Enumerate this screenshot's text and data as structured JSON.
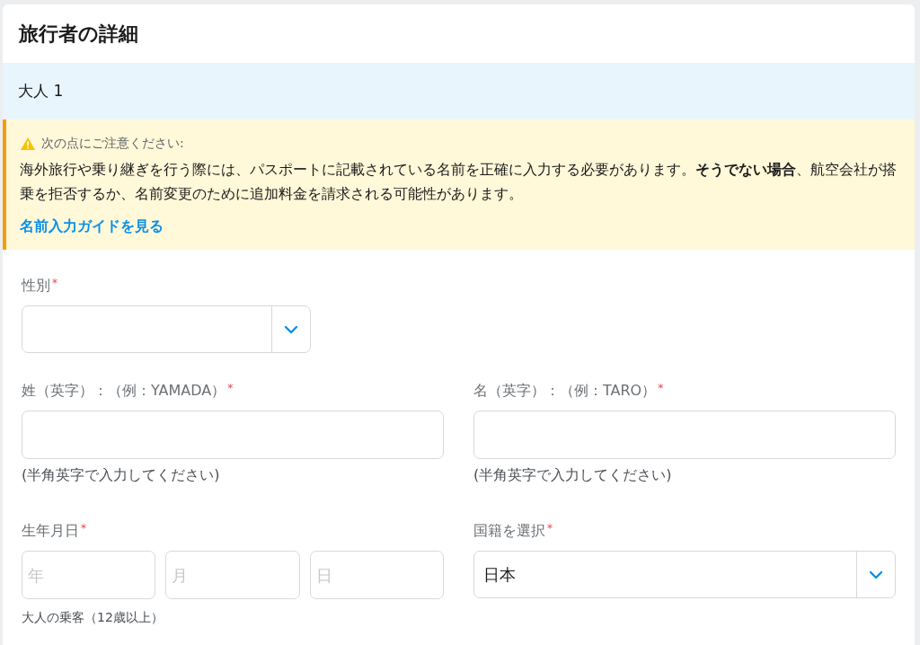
{
  "title": "旅行者の詳細",
  "passenger": "大人 1",
  "notice": {
    "heading": "次の点にご注意ください:",
    "body": "海外旅行や乗り継ぎを行う際には、パスポートに記載されている名前を正確に入力する必要があります。**そうでない場合**、航空会社が搭乗を拒否するか、名前変更のために追加料金を請求される可能性があります。",
    "link": "名前入力ガイドを見る"
  },
  "gender": {
    "label": "性別",
    "required_mark": "*"
  },
  "last_name": {
    "label": "姓（英字）：（例：YAMADA）",
    "required_mark": "*",
    "hint": "(半角英字で入力してください)"
  },
  "first_name": {
    "label": "名（英字）：（例：TARO）",
    "required_mark": "*",
    "hint": "(半角英字で入力してください)"
  },
  "birth_date": {
    "label": "生年月日",
    "required_mark": "*",
    "placeholders": [
      "年",
      "月",
      "日"
    ],
    "note": "大人の乗客（12歳以上）"
  },
  "nationality": {
    "label": "国籍を選択",
    "required_mark": "*",
    "value": "日本"
  }
}
